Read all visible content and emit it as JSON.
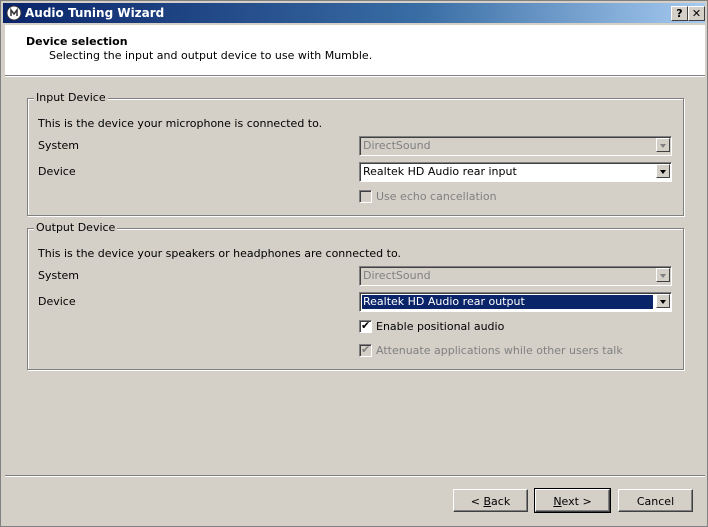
{
  "window": {
    "title": "Audio Tuning Wizard",
    "help_glyph": "?",
    "close_glyph": "✕"
  },
  "header": {
    "title": "Device selection",
    "subtitle": "Selecting the input and output device to use with Mumble."
  },
  "input": {
    "legend": "Input Device",
    "description": "This is the device your microphone is connected to.",
    "system_label": "System",
    "system_value": "DirectSound",
    "device_label": "Device",
    "device_value": "Realtek HD Audio rear input",
    "echo_label": "Use echo cancellation",
    "echo_checked": false
  },
  "output": {
    "legend": "Output Device",
    "description": "This is the device your speakers or headphones are connected to.",
    "system_label": "System",
    "system_value": "DirectSound",
    "device_label": "Device",
    "device_value": "Realtek HD Audio rear output",
    "positional_label": "Enable positional audio",
    "positional_mark": "✔",
    "attenuate_label": "Attenuate applications while other users talk",
    "attenuate_mark": "✔"
  },
  "buttons": {
    "back_prefix": "< ",
    "back_accel": "B",
    "back_rest": "ack",
    "next_accel": "N",
    "next_rest": "ext >",
    "cancel": "Cancel"
  },
  "colors": {
    "titlebar_start": "#0a246a",
    "selection": "#0a246a",
    "face": "#d4d0c8"
  }
}
